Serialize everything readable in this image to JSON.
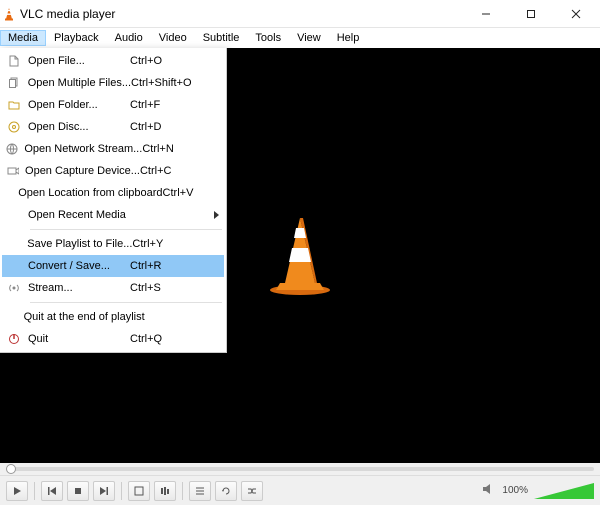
{
  "titlebar": {
    "title": "VLC media player"
  },
  "menubar": {
    "items": [
      "Media",
      "Playback",
      "Audio",
      "Video",
      "Subtitle",
      "Tools",
      "View",
      "Help"
    ],
    "active_index": 0
  },
  "media_menu": {
    "highlighted_index": 9,
    "items": [
      {
        "icon": "file-icon",
        "label": "Open File...",
        "shortcut": "Ctrl+O"
      },
      {
        "icon": "files-icon",
        "label": "Open Multiple Files...",
        "shortcut": "Ctrl+Shift+O"
      },
      {
        "icon": "folder-icon",
        "label": "Open Folder...",
        "shortcut": "Ctrl+F"
      },
      {
        "icon": "disc-icon",
        "label": "Open Disc...",
        "shortcut": "Ctrl+D"
      },
      {
        "icon": "network-icon",
        "label": "Open Network Stream...",
        "shortcut": "Ctrl+N"
      },
      {
        "icon": "capture-icon",
        "label": "Open Capture Device...",
        "shortcut": "Ctrl+C"
      },
      {
        "icon": "",
        "label": "Open Location from clipboard",
        "shortcut": "Ctrl+V"
      },
      {
        "icon": "",
        "label": "Open Recent Media",
        "shortcut": "",
        "submenu": true
      },
      {
        "type": "divider"
      },
      {
        "icon": "",
        "label": "Save Playlist to File...",
        "shortcut": "Ctrl+Y"
      },
      {
        "icon": "",
        "label": "Convert / Save...",
        "shortcut": "Ctrl+R"
      },
      {
        "icon": "stream-icon",
        "label": "Stream...",
        "shortcut": "Ctrl+S"
      },
      {
        "type": "divider"
      },
      {
        "icon": "",
        "label": "Quit at the end of playlist",
        "shortcut": ""
      },
      {
        "icon": "quit-icon",
        "label": "Quit",
        "shortcut": "Ctrl+Q"
      }
    ]
  },
  "volume": {
    "percent_label": "100%"
  }
}
